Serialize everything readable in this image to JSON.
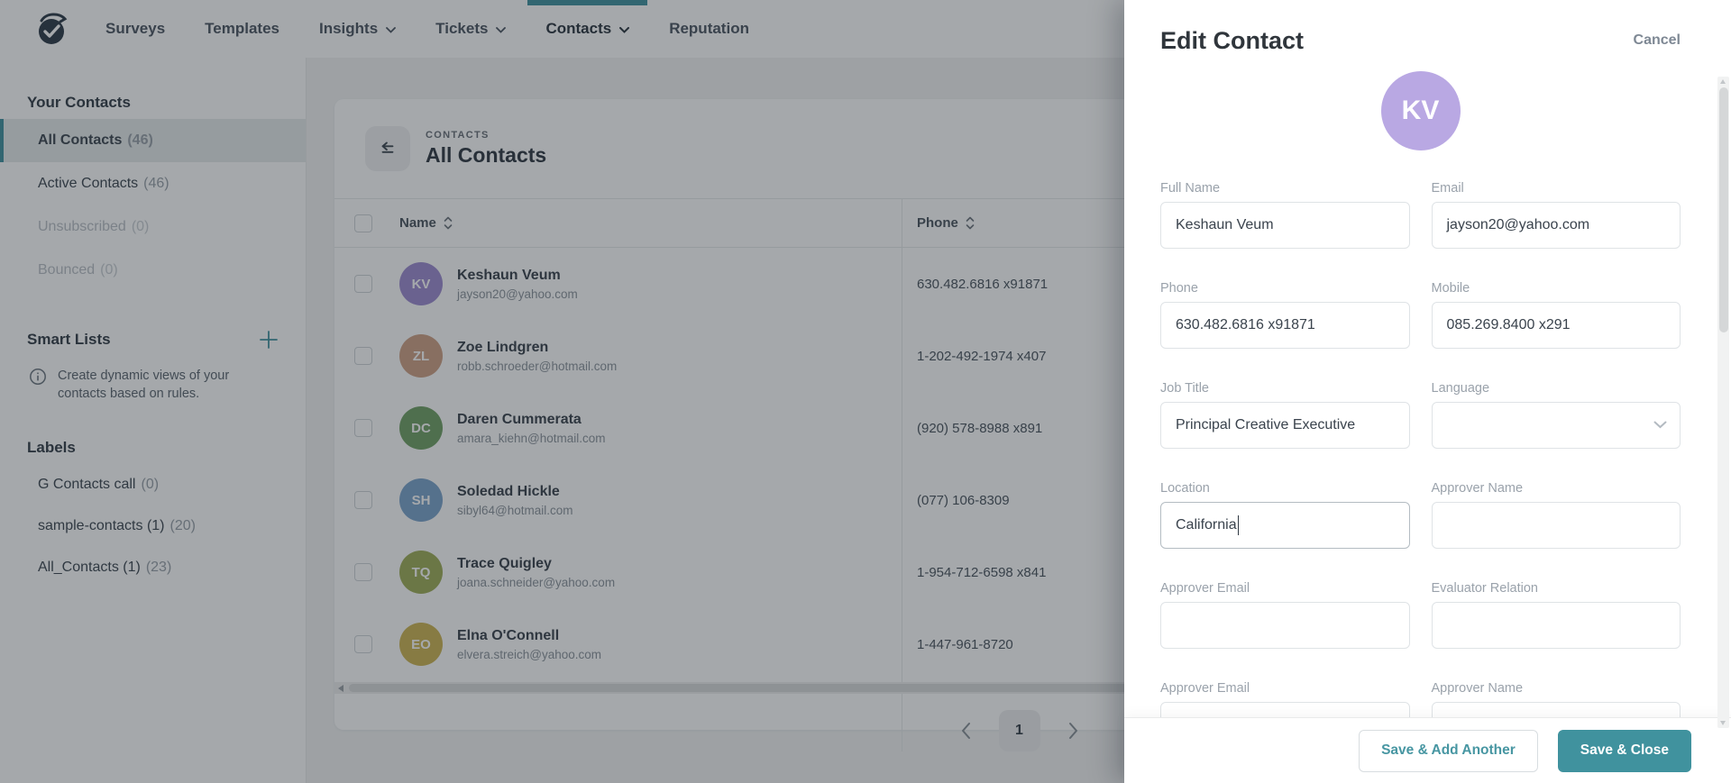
{
  "colors": {
    "accent": "#40929e",
    "panel_avatar": "#b9a8e3",
    "overlay": "rgba(30,38,46,0.40)"
  },
  "nav": {
    "items": [
      {
        "label": "Surveys"
      },
      {
        "label": "Templates"
      },
      {
        "label": "Insights"
      },
      {
        "label": "Tickets"
      },
      {
        "label": "Contacts"
      },
      {
        "label": "Reputation"
      }
    ]
  },
  "sidebar": {
    "your_contacts_title": "Your Contacts",
    "items": [
      {
        "label": "All Contacts",
        "count": "(46)"
      },
      {
        "label": "Active Contacts",
        "count": "(46)"
      },
      {
        "label": "Unsubscribed",
        "count": "(0)"
      },
      {
        "label": "Bounced",
        "count": "(0)"
      }
    ],
    "smart_lists_title": "Smart Lists",
    "smart_lists_info": "Create dynamic views of your contacts based on rules.",
    "labels_title": "Labels",
    "labels": [
      {
        "label": "G Contacts call",
        "count": "(0)"
      },
      {
        "label": "sample-contacts (1)",
        "count": "(20)"
      },
      {
        "label": "All_Contacts (1)",
        "count": "(23)"
      }
    ]
  },
  "main": {
    "breadcrumb": "CONTACTS",
    "title": "All Contacts",
    "columns": {
      "name": "Name",
      "phone": "Phone"
    },
    "rows": [
      {
        "initials": "KV",
        "avatar_color": "#9d8bd0",
        "name": "Keshaun Veum",
        "email": "jayson20@yahoo.com",
        "phone": "630.482.6816 x91871"
      },
      {
        "initials": "ZL",
        "avatar_color": "#cfa184",
        "name": "Zoe Lindgren",
        "email": "robb.schroeder@hotmail.com",
        "phone": "1-202-492-1974 x407"
      },
      {
        "initials": "DC",
        "avatar_color": "#71a164",
        "name": "Daren Cummerata",
        "email": "amara_kiehn@hotmail.com",
        "phone": "(920) 578-8988 x891"
      },
      {
        "initials": "SH",
        "avatar_color": "#7ba3cc",
        "name": "Soledad Hickle",
        "email": "sibyl64@hotmail.com",
        "phone": "(077) 106-8309"
      },
      {
        "initials": "TQ",
        "avatar_color": "#9fae57",
        "name": "Trace Quigley",
        "email": "joana.schneider@yahoo.com",
        "phone": "1-954-712-6598 x841"
      },
      {
        "initials": "EO",
        "avatar_color": "#cdb552",
        "name": "Elna O'Connell",
        "email": "elvera.streich@yahoo.com",
        "phone": "1-447-961-8720"
      }
    ],
    "pagination": {
      "current_page": "1"
    }
  },
  "panel": {
    "title": "Edit Contact",
    "cancel_label": "Cancel",
    "avatar_initials": "KV",
    "fields": {
      "full_name": {
        "label": "Full Name",
        "value": "Keshaun Veum"
      },
      "email": {
        "label": "Email",
        "value": "jayson20@yahoo.com"
      },
      "phone": {
        "label": "Phone",
        "value": "630.482.6816 x91871"
      },
      "mobile": {
        "label": "Mobile",
        "value": "085.269.8400 x291"
      },
      "job_title": {
        "label": "Job Title",
        "value": "Principal Creative Executive"
      },
      "language": {
        "label": "Language",
        "value": ""
      },
      "location": {
        "label": "Location",
        "value": "California"
      },
      "approver_name": {
        "label": "Approver Name",
        "value": ""
      },
      "approver_email": {
        "label": "Approver Email",
        "value": ""
      },
      "evaluator_relation": {
        "label": "Evaluator Relation",
        "value": ""
      },
      "approver_email_2": {
        "label": "Approver Email",
        "value": ""
      },
      "approver_name_2": {
        "label": "Approver Name",
        "value": ""
      }
    },
    "footer": {
      "save_add_label": "Save & Add Another",
      "save_close_label": "Save & Close"
    }
  }
}
